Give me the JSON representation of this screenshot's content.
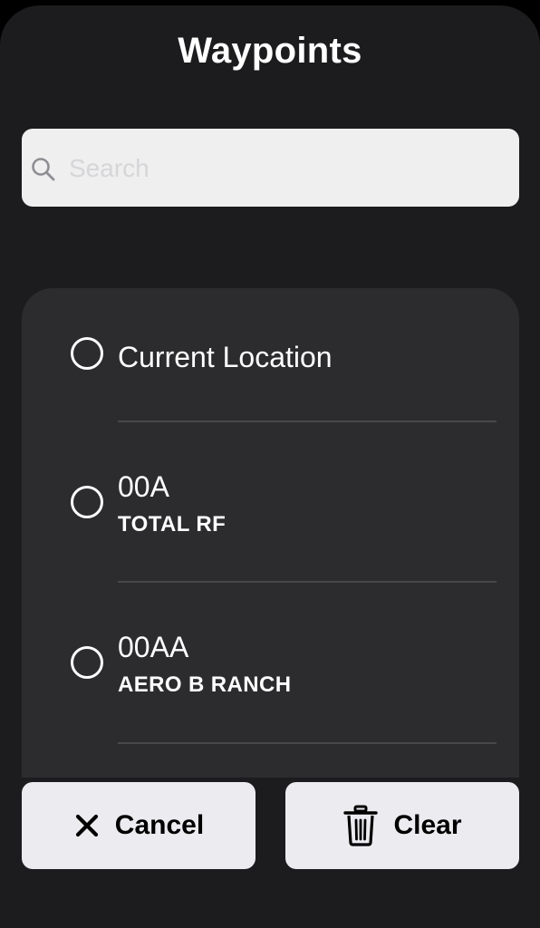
{
  "header": {
    "title": "Waypoints"
  },
  "search": {
    "value": "",
    "placeholder": "Search",
    "icon": "search-icon"
  },
  "waypoints": [
    {
      "title": "Current Location",
      "subtitle": "",
      "selected": false
    },
    {
      "title": "00A",
      "subtitle": "TOTAL RF",
      "selected": false
    },
    {
      "title": "00AA",
      "subtitle": "AERO B RANCH",
      "selected": false
    }
  ],
  "actions": {
    "cancel_label": "Cancel",
    "cancel_icon": "close-icon",
    "clear_label": "Clear",
    "clear_icon": "trash-icon"
  },
  "colors": {
    "background": "#1c1c1e",
    "card": "#2c2c2e",
    "search_field": "#efeff0",
    "button": "#ececf0",
    "text": "#ffffff"
  }
}
